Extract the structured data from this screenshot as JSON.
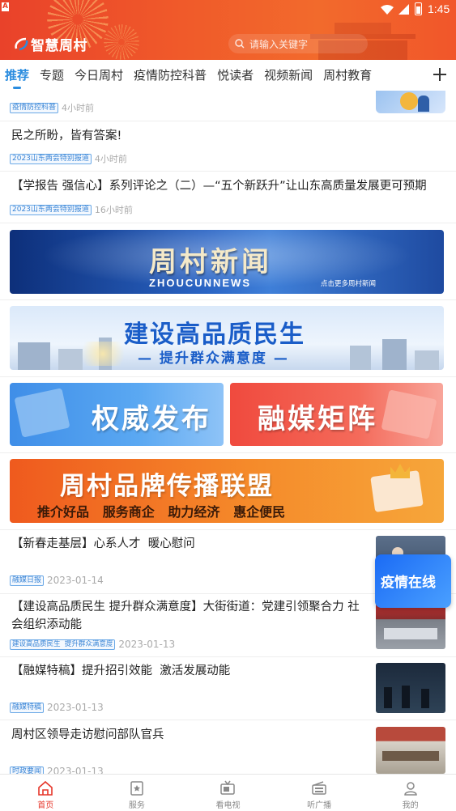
{
  "status_bar": {
    "time": "1:45",
    "sim": "A"
  },
  "header": {
    "app_name": "智慧周村",
    "search_placeholder": "请输入关键字"
  },
  "tabs": [
    {
      "label": "推荐",
      "active": true
    },
    {
      "label": "专题"
    },
    {
      "label": "今日周村"
    },
    {
      "label": "疫情防控科普"
    },
    {
      "label": "悦读者"
    },
    {
      "label": "视频新闻"
    },
    {
      "label": "周村教育"
    }
  ],
  "feed": {
    "item0": {
      "tag": "疫情防控科普",
      "time": "4小时前"
    },
    "item1": {
      "title": "民之所盼，皆有答案!",
      "tag": "2023山东两会特别报道",
      "time": "4小时前"
    },
    "item2": {
      "title": "【学报告  强信心】系列评论之（二）—“五个新跃升”让山东高质量发展更可预期",
      "tag": "2023山东两会特别报道",
      "time": "16小时前"
    },
    "banner_news": {
      "title": "周村新闻",
      "subtitle": "ZHOUCUNNEWS",
      "link": "点击更多周村新闻"
    },
    "banner_quality": {
      "title": "建设高品质民生",
      "subtitle": "— 提升群众满意度 —"
    },
    "banner_authority": {
      "title": "权威发布"
    },
    "banner_media": {
      "title": "融媒矩阵"
    },
    "banner_brand": {
      "title": "周村品牌传播联盟",
      "subtitle": "推介好品   服务商企   助力经济   惠企便民"
    },
    "item3": {
      "title": "【新春走基层】心系人才  暖心慰问",
      "tag": "融媒日报",
      "time": "2023-01-14"
    },
    "item4": {
      "title": "【建设高品质民生  提升群众满意度】大街街道：党建引领聚合力  社会组织添动能",
      "tag": "建设高品质民生  提升群众满意度",
      "time": "2023-01-13"
    },
    "item5": {
      "title": "【融媒特稿】提升招引效能  激活发展动能",
      "tag": "融媒特稿",
      "time": "2023-01-13"
    },
    "item6": {
      "title": "周村区领导走访慰问部队官兵",
      "tag": "时政要闻",
      "time": "2023-01-13"
    }
  },
  "floating_button": {
    "label": "疫情在线"
  },
  "bottom_nav": [
    {
      "label": "首页",
      "icon": "home-icon",
      "active": true
    },
    {
      "label": "服务",
      "icon": "service-icon"
    },
    {
      "label": "看电视",
      "icon": "tv-icon"
    },
    {
      "label": "听广播",
      "icon": "radio-icon"
    },
    {
      "label": "我的",
      "icon": "user-icon"
    }
  ],
  "colors": {
    "header": "#ef4f2a",
    "accent": "#2a8cdf",
    "nav_active": "#e6362a"
  }
}
